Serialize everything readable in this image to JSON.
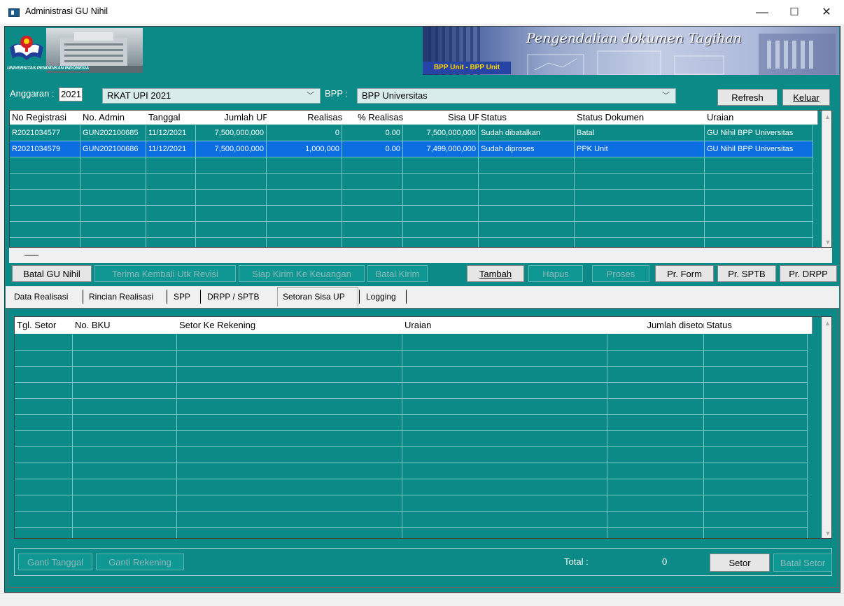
{
  "window": {
    "title": "Administrasi GU Nihil",
    "minimize": "—",
    "maximize": "☐",
    "close": "✕"
  },
  "banner": {
    "university": "UNIVERSITAS PENDIDIKAN INDONESIA",
    "app_title": "Pengendalian dokumen Tagihan",
    "unit": "BPP Unit - BPP Unit"
  },
  "filter": {
    "anggaran_label": "Anggaran :",
    "year": "2021",
    "rkat": "RKAT UPI 2021",
    "bpp_label": "BPP :",
    "bpp": "BPP Universitas",
    "refresh": "Refresh",
    "keluar": "Keluar"
  },
  "top_grid": {
    "columns": [
      "No Registrasi",
      "No. Admin",
      "Tanggal",
      "Jumlah UP",
      "Realisasi",
      "% Realisasi",
      "Sisa UP",
      "Status",
      "Status Dokumen",
      "Uraian"
    ],
    "rows": [
      [
        "R2021034577",
        "GUN202100685",
        "11/12/2021",
        "7,500,000,000",
        "0",
        "0.00",
        "7,500,000,000",
        "Sudah dibatalkan",
        "Batal",
        "GU Nihil BPP Universitas"
      ],
      [
        "R2021034579",
        "GUN202100686",
        "11/12/2021",
        "7,500,000,000",
        "1,000,000",
        "0.00",
        "7,499,000,000",
        "Sudah diproses",
        "PPK Unit",
        "GU Nihil BPP Universitas"
      ]
    ],
    "selected_row": 1
  },
  "actions": {
    "batal_gu_nihil": "Batal GU Nihil",
    "terima_kembali": "Terima Kembali Utk Revisi",
    "siap_kirim": "Siap Kirim Ke Keuangan",
    "batal_kirim": "Batal Kirim",
    "tambah": "Tambah",
    "hapus": "Hapus",
    "proses": "Proses",
    "pr_form": "Pr. Form",
    "pr_sptb": "Pr. SPTB",
    "pr_drpp": "Pr. DRPP"
  },
  "tabs": [
    "Data Realisasi",
    "Rincian Realisasi",
    "SPP",
    "DRPP / SPTB",
    "Setoran Sisa UP",
    "Logging"
  ],
  "active_tab": "Setoran Sisa UP",
  "bottom_grid": {
    "columns": [
      "Tgl. Setor",
      "No. BKU",
      "Setor Ke Rekening",
      "Uraian",
      "Jumlah disetor",
      "Status"
    ]
  },
  "footer": {
    "ganti_tanggal": "Ganti Tanggal",
    "ganti_rekening": "Ganti Rekening",
    "total_label": "Total :",
    "total_value": "0",
    "setor": "Setor",
    "batal_setor": "Batal Setor"
  },
  "colors": {
    "teal": "#0b8a87",
    "selected": "#0a6ee0",
    "header_bg": "#ffffff"
  }
}
